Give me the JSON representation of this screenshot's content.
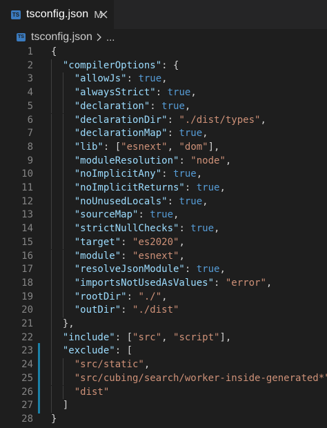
{
  "tab": {
    "icon_text": "TS",
    "label": "tsconfig.json",
    "modified": "M"
  },
  "breadcrumb": {
    "icon_text": "TS",
    "file": "tsconfig.json",
    "more": "..."
  },
  "colors": {
    "key": "#9cdcfe",
    "string": "#ce9178",
    "keyword": "#569cd6",
    "punct": "#d4d4d4",
    "line_number": "#858585",
    "gutter_modified": "#1b81a8"
  },
  "lines": [
    {
      "n": "1",
      "indent": 0,
      "tokens": [
        [
          "pn",
          "{"
        ]
      ]
    },
    {
      "n": "2",
      "indent": 1,
      "tokens": [
        [
          "key",
          "\"compilerOptions\""
        ],
        [
          "pn",
          ": {"
        ]
      ]
    },
    {
      "n": "3",
      "indent": 2,
      "tokens": [
        [
          "key",
          "\"allowJs\""
        ],
        [
          "pn",
          ": "
        ],
        [
          "kw",
          "true"
        ],
        [
          "pn",
          ","
        ]
      ]
    },
    {
      "n": "4",
      "indent": 2,
      "tokens": [
        [
          "key",
          "\"alwaysStrict\""
        ],
        [
          "pn",
          ": "
        ],
        [
          "kw",
          "true"
        ],
        [
          "pn",
          ","
        ]
      ]
    },
    {
      "n": "5",
      "indent": 2,
      "tokens": [
        [
          "key",
          "\"declaration\""
        ],
        [
          "pn",
          ": "
        ],
        [
          "kw",
          "true"
        ],
        [
          "pn",
          ","
        ]
      ]
    },
    {
      "n": "6",
      "indent": 2,
      "tokens": [
        [
          "key",
          "\"declarationDir\""
        ],
        [
          "pn",
          ": "
        ],
        [
          "str",
          "\"./dist/types\""
        ],
        [
          "pn",
          ","
        ]
      ]
    },
    {
      "n": "7",
      "indent": 2,
      "tokens": [
        [
          "key",
          "\"declarationMap\""
        ],
        [
          "pn",
          ": "
        ],
        [
          "kw",
          "true"
        ],
        [
          "pn",
          ","
        ]
      ]
    },
    {
      "n": "8",
      "indent": 2,
      "tokens": [
        [
          "key",
          "\"lib\""
        ],
        [
          "pn",
          ": ["
        ],
        [
          "str",
          "\"esnext\""
        ],
        [
          "pn",
          ", "
        ],
        [
          "str",
          "\"dom\""
        ],
        [
          "pn",
          "],"
        ]
      ]
    },
    {
      "n": "9",
      "indent": 2,
      "tokens": [
        [
          "key",
          "\"moduleResolution\""
        ],
        [
          "pn",
          ": "
        ],
        [
          "str",
          "\"node\""
        ],
        [
          "pn",
          ","
        ]
      ]
    },
    {
      "n": "10",
      "indent": 2,
      "tokens": [
        [
          "key",
          "\"noImplicitAny\""
        ],
        [
          "pn",
          ": "
        ],
        [
          "kw",
          "true"
        ],
        [
          "pn",
          ","
        ]
      ]
    },
    {
      "n": "11",
      "indent": 2,
      "tokens": [
        [
          "key",
          "\"noImplicitReturns\""
        ],
        [
          "pn",
          ": "
        ],
        [
          "kw",
          "true"
        ],
        [
          "pn",
          ","
        ]
      ]
    },
    {
      "n": "12",
      "indent": 2,
      "tokens": [
        [
          "key",
          "\"noUnusedLocals\""
        ],
        [
          "pn",
          ": "
        ],
        [
          "kw",
          "true"
        ],
        [
          "pn",
          ","
        ]
      ]
    },
    {
      "n": "13",
      "indent": 2,
      "tokens": [
        [
          "key",
          "\"sourceMap\""
        ],
        [
          "pn",
          ": "
        ],
        [
          "kw",
          "true"
        ],
        [
          "pn",
          ","
        ]
      ]
    },
    {
      "n": "14",
      "indent": 2,
      "tokens": [
        [
          "key",
          "\"strictNullChecks\""
        ],
        [
          "pn",
          ": "
        ],
        [
          "kw",
          "true"
        ],
        [
          "pn",
          ","
        ]
      ]
    },
    {
      "n": "15",
      "indent": 2,
      "tokens": [
        [
          "key",
          "\"target\""
        ],
        [
          "pn",
          ": "
        ],
        [
          "str",
          "\"es2020\""
        ],
        [
          "pn",
          ","
        ]
      ]
    },
    {
      "n": "16",
      "indent": 2,
      "tokens": [
        [
          "key",
          "\"module\""
        ],
        [
          "pn",
          ": "
        ],
        [
          "str",
          "\"esnext\""
        ],
        [
          "pn",
          ","
        ]
      ]
    },
    {
      "n": "17",
      "indent": 2,
      "tokens": [
        [
          "key",
          "\"resolveJsonModule\""
        ],
        [
          "pn",
          ": "
        ],
        [
          "kw",
          "true"
        ],
        [
          "pn",
          ","
        ]
      ]
    },
    {
      "n": "18",
      "indent": 2,
      "tokens": [
        [
          "key",
          "\"importsNotUsedAsValues\""
        ],
        [
          "pn",
          ": "
        ],
        [
          "str",
          "\"error\""
        ],
        [
          "pn",
          ","
        ]
      ]
    },
    {
      "n": "19",
      "indent": 2,
      "tokens": [
        [
          "key",
          "\"rootDir\""
        ],
        [
          "pn",
          ": "
        ],
        [
          "str",
          "\"./\""
        ],
        [
          "pn",
          ","
        ]
      ]
    },
    {
      "n": "20",
      "indent": 2,
      "tokens": [
        [
          "key",
          "\"outDir\""
        ],
        [
          "pn",
          ": "
        ],
        [
          "str",
          "\"./dist\""
        ]
      ]
    },
    {
      "n": "21",
      "indent": 1,
      "tokens": [
        [
          "pn",
          "},"
        ]
      ]
    },
    {
      "n": "22",
      "indent": 1,
      "tokens": [
        [
          "key",
          "\"include\""
        ],
        [
          "pn",
          ": ["
        ],
        [
          "str",
          "\"src\""
        ],
        [
          "pn",
          ", "
        ],
        [
          "str",
          "\"script\""
        ],
        [
          "pn",
          "],"
        ]
      ]
    },
    {
      "n": "23",
      "indent": 1,
      "tokens": [
        [
          "key",
          "\"exclude\""
        ],
        [
          "pn",
          ": ["
        ]
      ]
    },
    {
      "n": "24",
      "indent": 2,
      "tokens": [
        [
          "str",
          "\"src/static\""
        ],
        [
          "pn",
          ","
        ]
      ]
    },
    {
      "n": "25",
      "indent": 2,
      "tokens": [
        [
          "str",
          "\"src/cubing/search/worker-inside-generated*\""
        ],
        [
          "pn",
          ","
        ]
      ]
    },
    {
      "n": "26",
      "indent": 2,
      "tokens": [
        [
          "str",
          "\"dist\""
        ]
      ]
    },
    {
      "n": "27",
      "indent": 1,
      "tokens": [
        [
          "pn",
          "]"
        ]
      ]
    },
    {
      "n": "28",
      "indent": 0,
      "tokens": [
        [
          "pn",
          "}"
        ]
      ]
    }
  ]
}
